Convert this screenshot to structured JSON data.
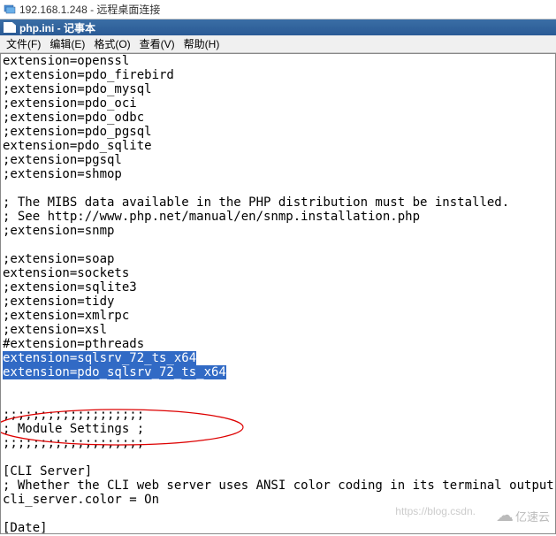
{
  "rdp": {
    "title": "192.168.1.248 - 远程桌面连接"
  },
  "notepad": {
    "title": "php.ini - 记事本"
  },
  "menu": {
    "file": "文件(F)",
    "edit": "编辑(E)",
    "format": "格式(O)",
    "view": "查看(V)",
    "help": "帮助(H)"
  },
  "content": {
    "lines": [
      "extension=openssl",
      ";extension=pdo_firebird",
      ";extension=pdo_mysql",
      ";extension=pdo_oci",
      ";extension=pdo_odbc",
      ";extension=pdo_pgsql",
      "extension=pdo_sqlite",
      ";extension=pgsql",
      ";extension=shmop",
      "",
      "; The MIBS data available in the PHP distribution must be installed.",
      "; See http://www.php.net/manual/en/snmp.installation.php",
      ";extension=snmp",
      "",
      ";extension=soap",
      "extension=sockets",
      ";extension=sqlite3",
      ";extension=tidy",
      ";extension=xmlrpc",
      ";extension=xsl",
      "#extension=pthreads"
    ],
    "highlighted1": "extension=sqlsrv_72_ts_x64",
    "highlighted2": "extension=pdo_sqlsrv_72_ts_x64",
    "lines_after": [
      "",
      "",
      ";;;;;;;;;;;;;;;;;;;",
      "; Module Settings ;",
      ";;;;;;;;;;;;;;;;;;;",
      "",
      "[CLI Server]",
      "; Whether the CLI web server uses ANSI color coding in its terminal output.",
      "cli_server.color = On",
      "",
      "[Date]"
    ]
  },
  "watermark": {
    "text": "https://blog.csdn.",
    "logo": "亿速云"
  }
}
